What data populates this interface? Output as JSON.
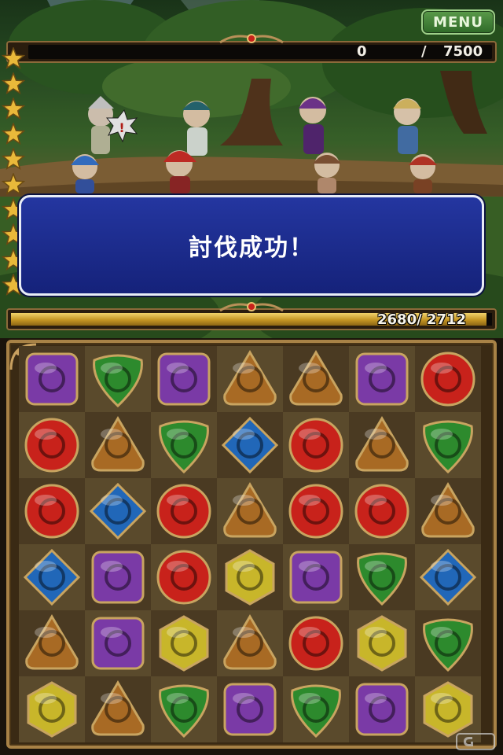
{
  "menu": {
    "label": "MENU"
  },
  "score": {
    "current": "0",
    "separator": "/",
    "target": "7500"
  },
  "stars": {
    "count": 10,
    "color": "#e9b93a"
  },
  "banner": {
    "text": "討伐成功！"
  },
  "enemy_hp": {
    "current": "2680/",
    "max": "2712",
    "fraction": 0.988
  },
  "board": {
    "columns": 7,
    "rows": 6,
    "grid": [
      [
        "dark",
        "wind",
        "dark",
        "earth",
        "earth",
        "dark",
        "fire"
      ],
      [
        "fire",
        "earth",
        "wind",
        "water",
        "fire",
        "earth",
        "wind"
      ],
      [
        "fire",
        "water",
        "fire",
        "earth",
        "fire",
        "fire",
        "earth"
      ],
      [
        "water",
        "dark",
        "fire",
        "light",
        "dark",
        "wind",
        "water"
      ],
      [
        "earth",
        "dark",
        "light",
        "earth",
        "fire",
        "light",
        "wind"
      ],
      [
        "light",
        "earth",
        "wind",
        "dark",
        "wind",
        "dark",
        "light"
      ]
    ],
    "gem_colors": {
      "fire": "#c8221b",
      "water": "#2167b8",
      "wind": "#2d8a2d",
      "earth": "#a86a24",
      "light": "#c8b62a",
      "dark": "#7a3aa6"
    }
  }
}
